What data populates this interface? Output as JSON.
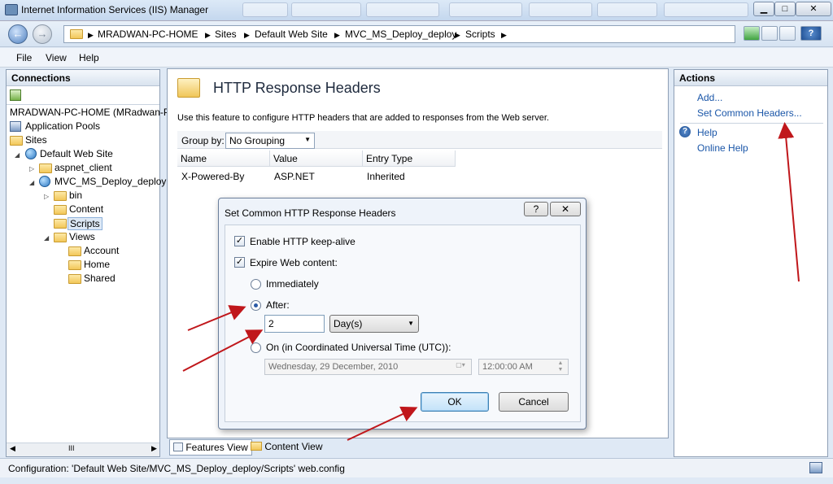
{
  "window": {
    "title": "Internet Information Services (IIS) Manager",
    "controls": {
      "minimize": "▁",
      "maximize": "□",
      "close": "✕"
    }
  },
  "address": {
    "back_icon": "←",
    "forward_icon": "→",
    "crumbs": [
      "MRADWAN-PC-HOME",
      "Sites",
      "Default Web Site",
      "MVC_MS_Deploy_deploy",
      "Scripts"
    ],
    "separator": "▶",
    "help_icon": "?"
  },
  "menu": {
    "items": [
      "File",
      "View",
      "Help"
    ]
  },
  "connections": {
    "header": "Connections",
    "tree": {
      "server": "MRADWAN-PC-HOME (MRadwan-P",
      "app_pools": "Application Pools",
      "sites": "Sites",
      "default_site": "Default Web Site",
      "aspnet_client": "aspnet_client",
      "mvc": "MVC_MS_Deploy_deploy",
      "bin": "bin",
      "content": "Content",
      "scripts": "Scripts",
      "views": "Views",
      "account": "Account",
      "home": "Home",
      "shared": "Shared"
    },
    "scroll_thumb": "III"
  },
  "main": {
    "title": "HTTP Response Headers",
    "description": "Use this feature to configure HTTP headers that are added to responses from the Web server.",
    "group_by_label": "Group by:",
    "group_by_value": "No Grouping",
    "columns": [
      "Name",
      "Value",
      "Entry Type"
    ],
    "rows": [
      {
        "name": "X-Powered-By",
        "value": "ASP.NET",
        "type": "Inherited"
      }
    ],
    "tabs": {
      "features": "Features View",
      "content": "Content View"
    }
  },
  "actions": {
    "header": "Actions",
    "add": "Add...",
    "set_common": "Set Common Headers...",
    "help": "Help",
    "online_help": "Online Help"
  },
  "dialog": {
    "title": "Set Common HTTP Response Headers",
    "help_btn": "?",
    "close_btn": "✕",
    "keepalive": "Enable HTTP keep-alive",
    "expire": "Expire Web content:",
    "immediately": "Immediately",
    "after": "After:",
    "after_value": "2",
    "after_unit": "Day(s)",
    "on_utc": "On (in Coordinated Universal Time (UTC)):",
    "date_value": "Wednesday, 29 December, 2010",
    "time_value": "12:00:00 AM",
    "ok": "OK",
    "cancel": "Cancel"
  },
  "status": {
    "text": "Configuration: 'Default Web Site/MVC_MS_Deploy_deploy/Scripts' web.config"
  },
  "colors": {
    "arrow": "#c0171b",
    "link": "#1a56a8"
  }
}
